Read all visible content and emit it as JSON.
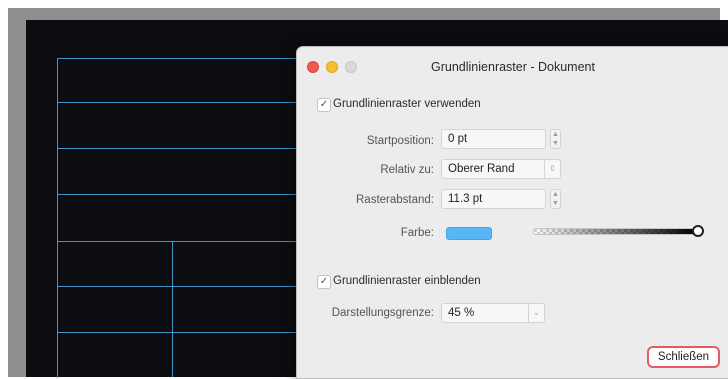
{
  "dialog": {
    "title": "Grundlinienraster - Dokument",
    "use_grid_label": "Grundlinienraster verwenden",
    "use_grid_checked": true,
    "start_position": {
      "label": "Startposition:",
      "value": "0 pt"
    },
    "relative_to": {
      "label": "Relativ zu:",
      "value": "Oberer Rand"
    },
    "grid_spacing": {
      "label": "Rasterabstand:",
      "value": "11.3 pt"
    },
    "color": {
      "label": "Farbe:",
      "swatch": "#55b8f4"
    },
    "show_grid_label": "Grundlinienraster einblenden",
    "show_grid_checked": true,
    "display_limit": {
      "label": "Darstellungsgrenze:",
      "value": "45 %"
    },
    "close_label": "Schließen"
  },
  "icons": {
    "check": "✓",
    "stepper_up": "▲",
    "stepper_down": "▼",
    "chevron_down": "⌄"
  }
}
